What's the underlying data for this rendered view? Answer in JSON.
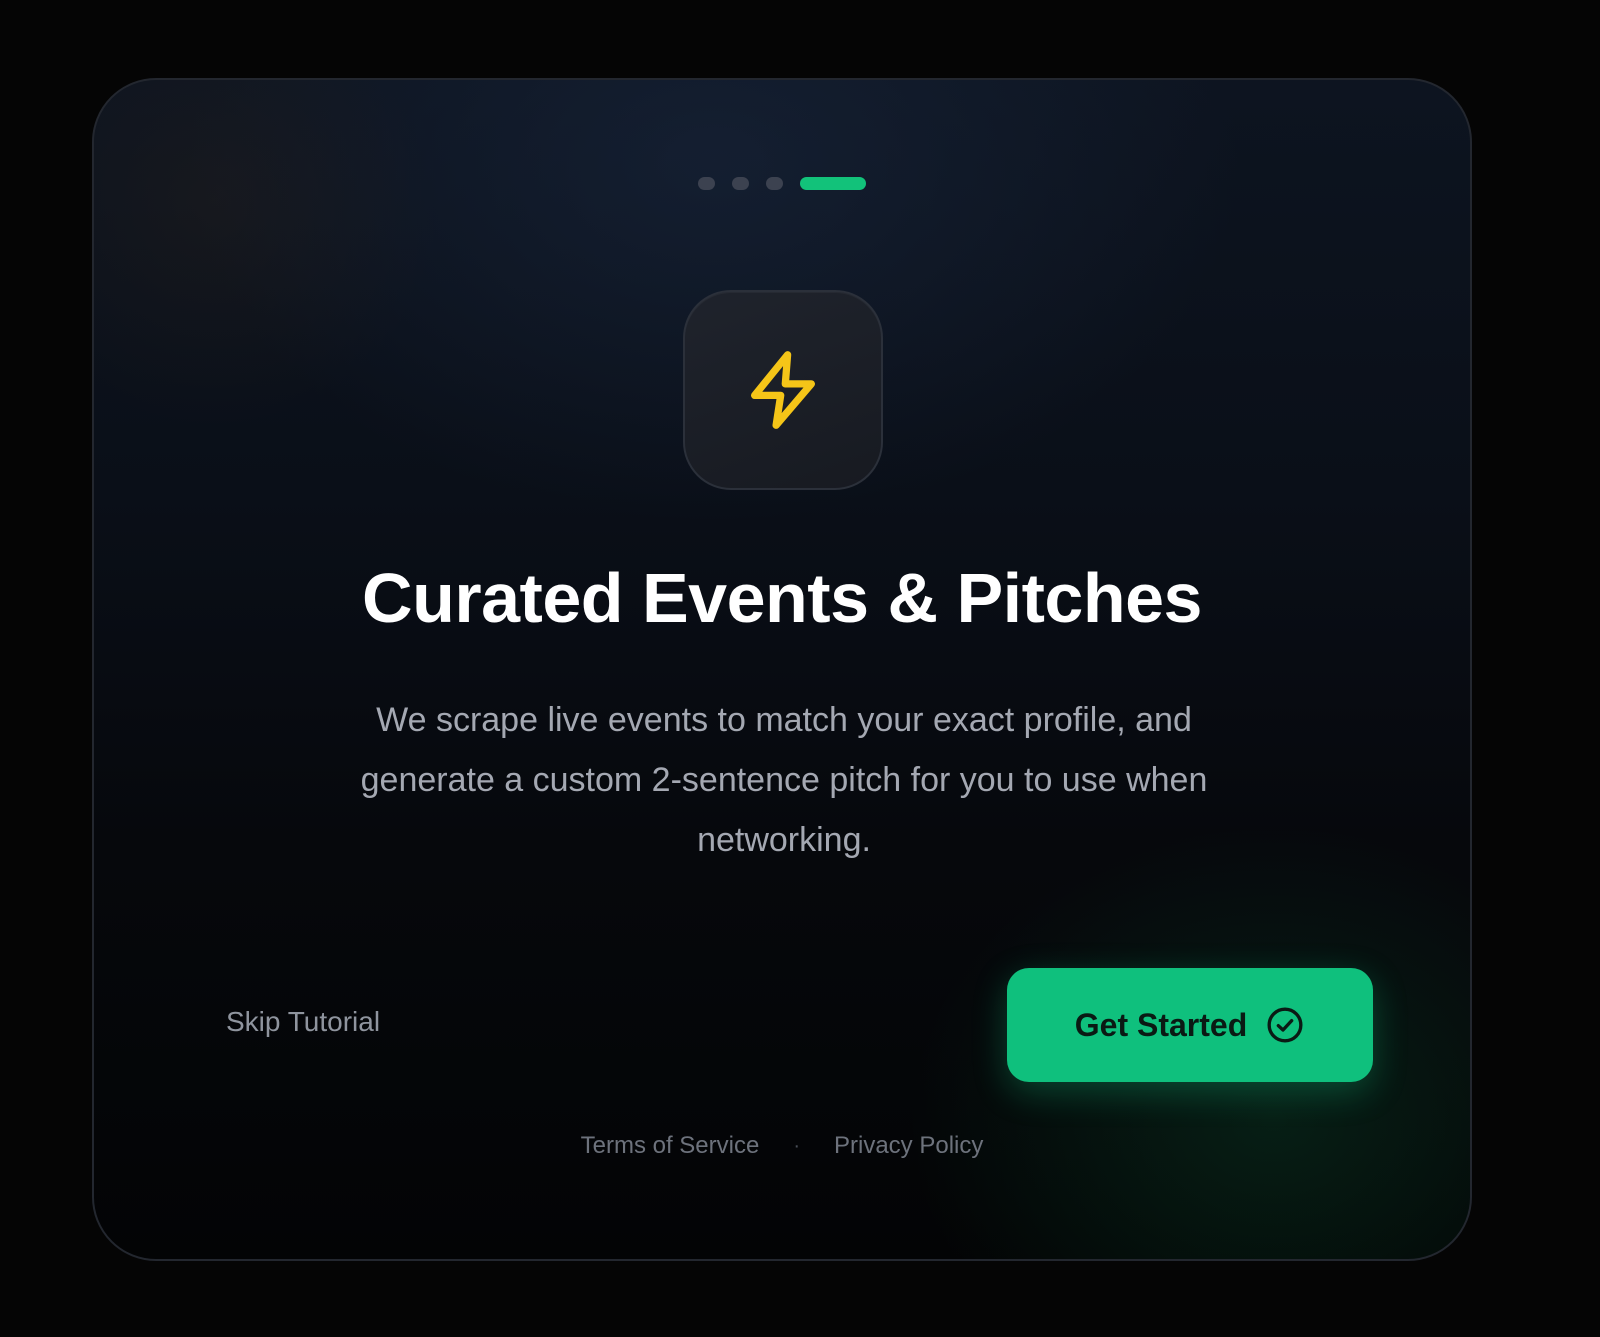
{
  "onboarding": {
    "pager": {
      "total": 4,
      "active_index": 3
    },
    "icon": {
      "name": "lightning-bolt-icon",
      "color": "#f5c518"
    },
    "title": "Curated Events & Pitches",
    "description": "We scrape live events to match your exact profile, and generate a custom 2-sentence pitch for you to use when networking.",
    "skip_label": "Skip Tutorial",
    "cta_label": "Get Started",
    "cta_icon": "check-circle-icon",
    "footer": {
      "terms_label": "Terms of Service",
      "separator": "·",
      "privacy_label": "Privacy Policy"
    }
  },
  "colors": {
    "accent": "#0fc07d",
    "bolt": "#f5c518",
    "background": "#050505"
  }
}
